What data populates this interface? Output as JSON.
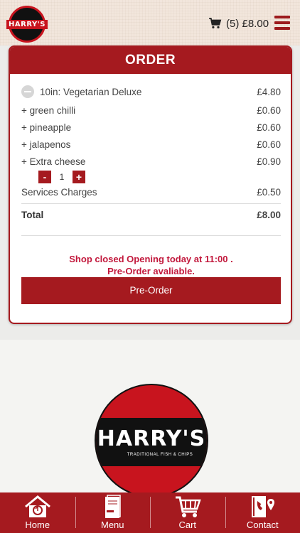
{
  "header": {
    "logo_text": "HARRY'S",
    "cart_summary": "(5) £8.00",
    "cart_icon": "cart-icon",
    "menu_icon": "hamburger-menu-icon"
  },
  "order": {
    "title": "ORDER",
    "item": {
      "name": "10in: Vegetarian Deluxe",
      "price": "£4.80"
    },
    "extras": [
      {
        "label": "+ green chilli",
        "price": "£0.60"
      },
      {
        "label": "+ pineapple",
        "price": "£0.60"
      },
      {
        "label": "+ jalapenos",
        "price": "£0.60"
      },
      {
        "label": "+ Extra cheese",
        "price": "£0.90"
      }
    ],
    "stepper": {
      "minus": "-",
      "quantity": "1",
      "plus": "+"
    },
    "service": {
      "label": "Services Charges",
      "price": "£0.50"
    },
    "total": {
      "label": "Total",
      "price": "£8.00"
    },
    "notice_line1": "Shop closed Opening today at 11:00 .",
    "notice_line2": "Pre-Order avaliable.",
    "preorder_label": "Pre-Order"
  },
  "logo": {
    "brand": "HARRY'S",
    "tagline": "TRADITIONAL FISH & CHIPS"
  },
  "bottom_nav": [
    {
      "label": "Home",
      "icon": "home-icon"
    },
    {
      "label": "Menu",
      "icon": "menu-book-icon"
    },
    {
      "label": "Cart",
      "icon": "cart-icon"
    },
    {
      "label": "Contact",
      "icon": "contact-icon"
    }
  ],
  "colors": {
    "brand_red": "#a51a1f",
    "notice_red": "#c2183c",
    "header_bg": "#f2e6dc"
  }
}
